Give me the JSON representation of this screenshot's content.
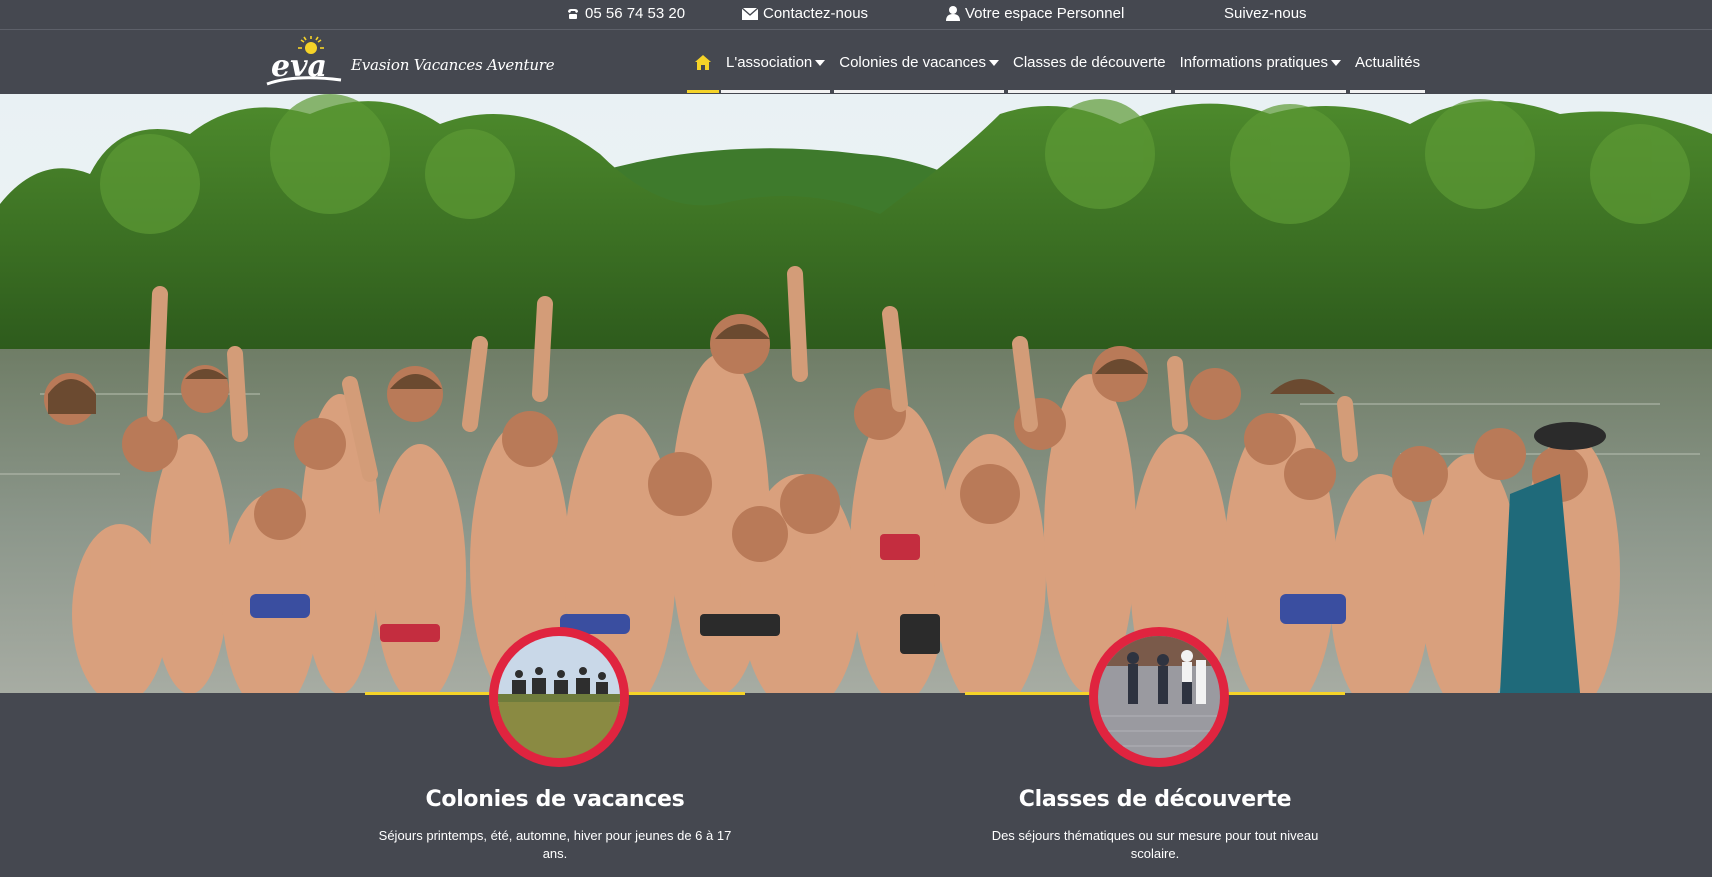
{
  "topbar": {
    "phone": "05 56 74 53 20",
    "contact": "Contactez-nous",
    "personal_space": "Votre espace Personnel",
    "follow": "Suivez-nous"
  },
  "brand": {
    "logo_mark": "eva",
    "name": "Evasion Vacances Aventure"
  },
  "nav": {
    "home_icon": "home-icon",
    "items": [
      {
        "label": "L'association",
        "dropdown": true
      },
      {
        "label": "Colonies de vacances",
        "dropdown": true
      },
      {
        "label": "Classes de découverte",
        "dropdown": false
      },
      {
        "label": "Informations pratiques",
        "dropdown": true
      },
      {
        "label": "Actualités",
        "dropdown": false
      }
    ]
  },
  "features": [
    {
      "title": "Colonies de vacances",
      "description": "Séjours printemps, été, automne, hiver pour jeunes de 6 à 17 ans."
    },
    {
      "title": "Classes de découverte",
      "description": "Des séjours thématiques ou sur mesure pour tout niveau scolaire."
    }
  ],
  "colors": {
    "bar_bg": "#454850",
    "accent_yellow": "#f5d328",
    "accent_red": "#e0243f"
  }
}
